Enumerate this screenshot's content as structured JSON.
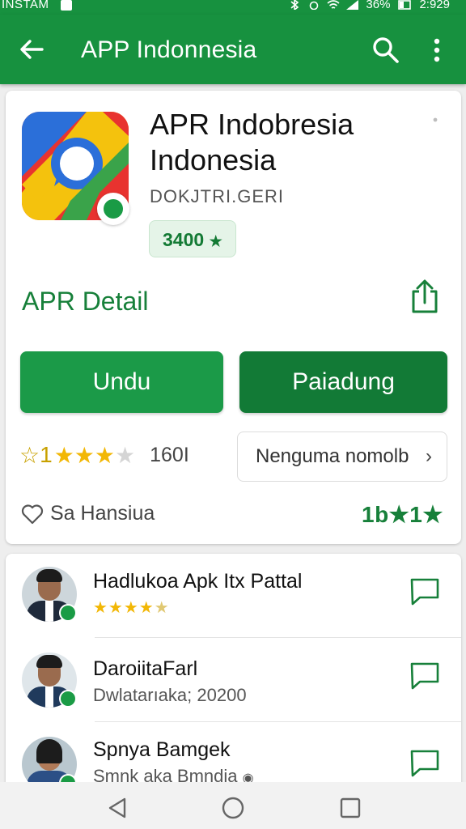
{
  "status_bar": {
    "carrier": "INSTAM",
    "battery_percent": "36%",
    "time": "2:929"
  },
  "app_bar": {
    "title": "APP Indonnesia"
  },
  "app": {
    "name": "APR Indobresia Indonesia",
    "developer": "DOKJTRI.GERI",
    "price_chip": "3400",
    "price_chip_star": "★",
    "detail_title": "APR Detail",
    "primary_button": "Undu",
    "secondary_button": "Paiadung",
    "rating_lead": "1",
    "rating_stars": 3,
    "rating_count": "160I",
    "manage_button": "Nenguma nomolb",
    "wishlist_label": "Sa Hansiua",
    "wishlist_count": "1b★1★",
    "accent_color": "#17913f"
  },
  "reviews": [
    {
      "name": "Hadlukoa Apk Itx Pattal",
      "stars": 4.5,
      "subtitle": ""
    },
    {
      "name": "DaroiitaFarl",
      "subtitle": "Dwlatarıaka; 20200"
    },
    {
      "name": "Spnya Bamgek",
      "subtitle": "Smnk aka Bmndia"
    }
  ],
  "icons": [
    "back-arrow-icon",
    "search-icon",
    "more-vert-icon",
    "share-icon",
    "heart-icon",
    "reply-icon",
    "nav-back-icon",
    "nav-home-icon",
    "nav-recents-icon"
  ]
}
